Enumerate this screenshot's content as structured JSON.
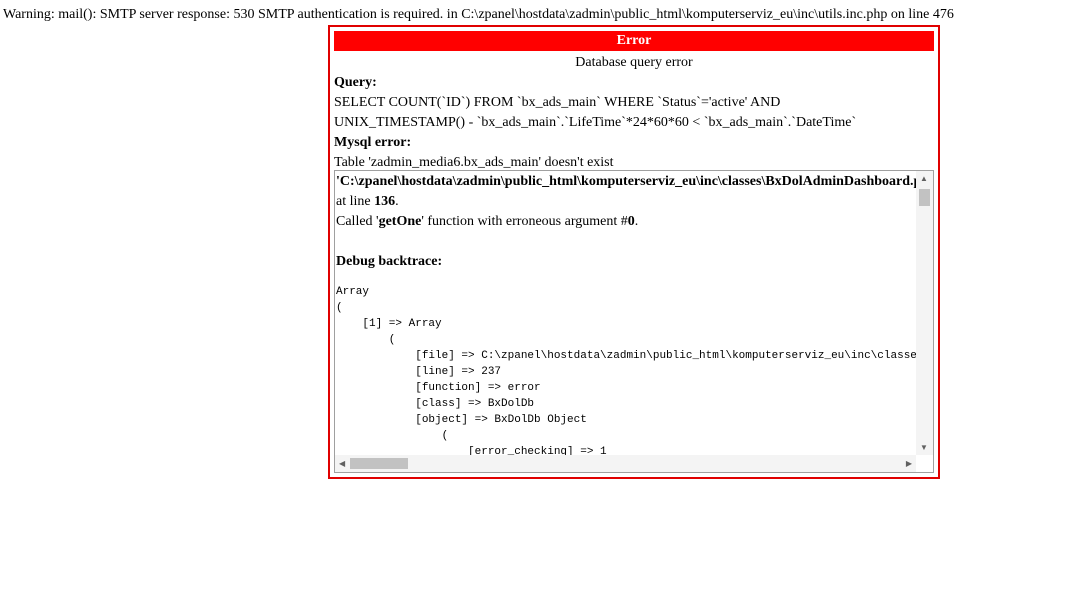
{
  "warning": "Warning: mail(): SMTP server response: 530 SMTP authentication is required. in C:\\zpanel\\hostdata\\zadmin\\public_html\\komputerserviz_eu\\inc\\utils.inc.php on line 476",
  "error": {
    "title": "Error",
    "subtitle": "Database query error",
    "query_label": "Query:",
    "query_line1": "SELECT COUNT(`ID`) FROM `bx_ads_main` WHERE `Status`='active' AND",
    "query_line2": "UNIX_TIMESTAMP() - `bx_ads_main`.`LifeTime`*24*60*60 < `bx_ads_main`.`DateTime`",
    "mysql_label": "Mysql error:",
    "mysql_error": "Table 'zadmin_media6.bx_ads_main' doesn't exist"
  },
  "details": {
    "file": "'C:\\zpanel\\hostdata\\zadmin\\public_html\\komputerserviz_eu\\inc\\classes\\BxDolAdminDashboard.php'",
    "at_line_prefix": "at line ",
    "line": "136",
    "period": ".",
    "called_prefix": "Called '",
    "function": "getOne",
    "called_mid": "' function with erroneous argument #",
    "argument": "0",
    "backtrace_label": "Debug backtrace:",
    "backtrace": "Array\n(\n    [1] => Array\n        (\n            [file] => C:\\zpanel\\hostdata\\zadmin\\public_html\\komputerserviz_eu\\inc\\classes\\BxDolAdminDashboard.php\n            [line] => 237\n            [function] => error\n            [class] => BxDolDb\n            [object] => BxDolDb Object\n                (\n                    [error_checking] => 1"
  }
}
